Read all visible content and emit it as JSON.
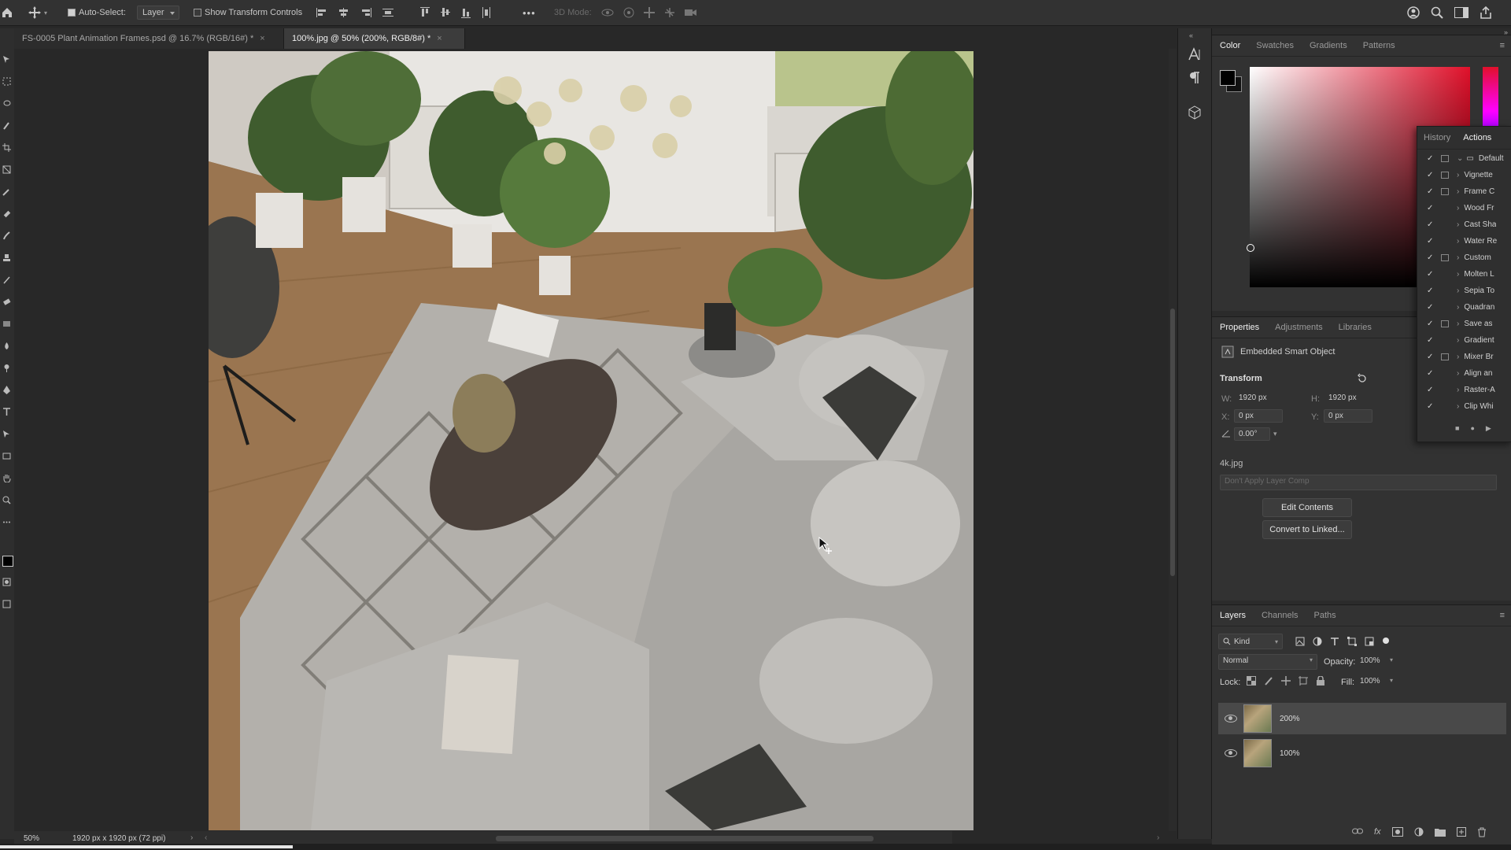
{
  "optionbar": {
    "auto_select_label": "Auto-Select:",
    "layer_dropdown": "Layer",
    "transform_controls_label": "Show Transform Controls",
    "more_label": "•••",
    "mode3d_label": "3D Mode:"
  },
  "tabs": [
    {
      "label": "FS-0005 Plant Animation Frames.psd @ 16.7% (RGB/16#) *",
      "close": "×"
    },
    {
      "label": "100%.jpg @ 50% (200%, RGB/8#) *",
      "close": "×"
    }
  ],
  "status": {
    "zoom": "50%",
    "doc_info": "1920 px x 1920 px (72 ppi)"
  },
  "color_panel": {
    "tabs": [
      "Color",
      "Swatches",
      "Gradients",
      "Patterns"
    ],
    "accent": "#e0102a"
  },
  "properties_panel": {
    "tabs": [
      "Properties",
      "Adjustments",
      "Libraries"
    ],
    "object_type": "Embedded Smart Object",
    "transform_label": "Transform",
    "w_label": "W:",
    "w_value": "1920 px",
    "h_label": "H:",
    "h_value": "1920 px",
    "x_label": "X:",
    "x_value": "0 px",
    "y_label": "Y:",
    "y_value": "0 px",
    "angle_value": "0.00°",
    "filename": "4k.jpg",
    "layer_comp_placeholder": "Don't Apply Layer Comp",
    "edit_contents_label": "Edit Contents",
    "convert_label": "Convert to Linked..."
  },
  "history_actions": {
    "tabs": [
      "History",
      "Actions"
    ],
    "items": [
      "Default",
      "Vignette",
      "Frame C",
      "Wood Fr",
      "Cast Sha",
      "Water Re",
      "Custom",
      "Molten L",
      "Sepia To",
      "Quadran",
      "Save as",
      "Gradient",
      "Mixer Br",
      "Align an",
      "Raster-A",
      "Clip Whi"
    ]
  },
  "layers_panel": {
    "tabs": [
      "Layers",
      "Channels",
      "Paths"
    ],
    "kind_label": "Kind",
    "blend_mode": "Normal",
    "opacity_label": "Opacity:",
    "opacity_value": "100%",
    "lock_label": "Lock:",
    "fill_label": "Fill:",
    "fill_value": "100%",
    "layers": [
      {
        "name": "200%",
        "selected": true
      },
      {
        "name": "100%",
        "selected": false
      }
    ]
  }
}
